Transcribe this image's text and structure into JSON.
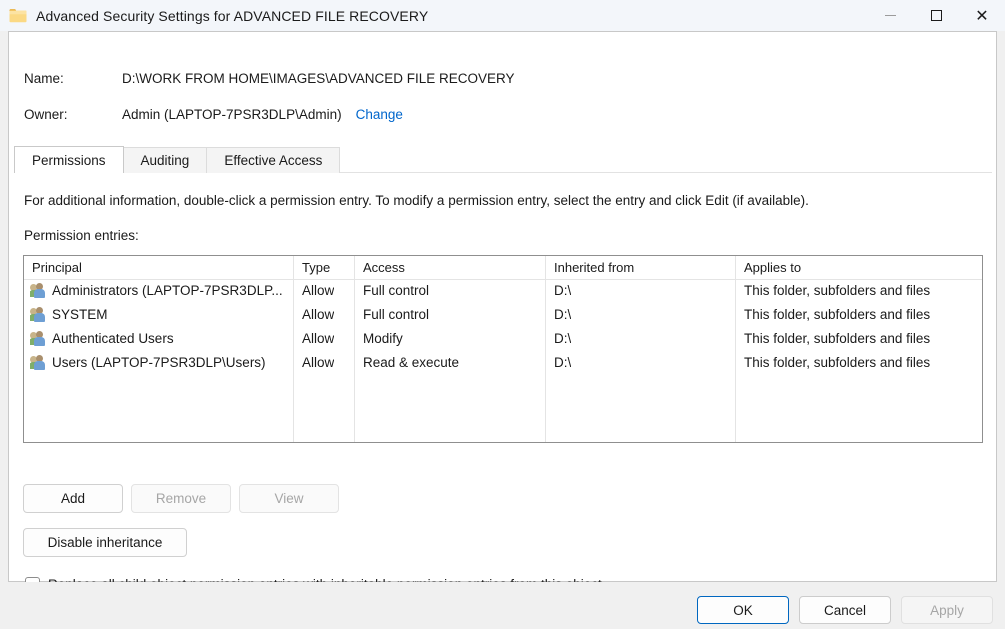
{
  "window": {
    "title": "Advanced Security Settings for ADVANCED FILE RECOVERY",
    "folder_icon": "folder-icon",
    "minimize_label": "Minimize",
    "maximize_label": "Maximize",
    "close_label": "Close"
  },
  "header": {
    "name_label": "Name:",
    "name_value": "D:\\WORK FROM HOME\\IMAGES\\ADVANCED FILE RECOVERY",
    "owner_label": "Owner:",
    "owner_value": "Admin (LAPTOP-7PSR3DLP\\Admin)",
    "change_link": "Change"
  },
  "tabs": [
    {
      "label": "Permissions",
      "active": true
    },
    {
      "label": "Auditing",
      "active": false
    },
    {
      "label": "Effective Access",
      "active": false
    }
  ],
  "main": {
    "info_text": "For additional information, double-click a permission entry. To modify a permission entry, select the entry and click Edit (if available).",
    "entries_label": "Permission entries:"
  },
  "table": {
    "columns": [
      "Principal",
      "Type",
      "Access",
      "Inherited from",
      "Applies to"
    ],
    "rows": [
      {
        "principal": "Administrators (LAPTOP-7PSR3DLP...",
        "type": "Allow",
        "access": "Full control",
        "inherited_from": "D:\\",
        "applies_to": "This folder, subfolders and files"
      },
      {
        "principal": "SYSTEM",
        "type": "Allow",
        "access": "Full control",
        "inherited_from": "D:\\",
        "applies_to": "This folder, subfolders and files"
      },
      {
        "principal": "Authenticated Users",
        "type": "Allow",
        "access": "Modify",
        "inherited_from": "D:\\",
        "applies_to": "This folder, subfolders and files"
      },
      {
        "principal": "Users (LAPTOP-7PSR3DLP\\Users)",
        "type": "Allow",
        "access": "Read & execute",
        "inherited_from": "D:\\",
        "applies_to": "This folder, subfolders and files"
      }
    ]
  },
  "actions": {
    "add": "Add",
    "remove": "Remove",
    "view": "View",
    "disable_inheritance": "Disable inheritance",
    "replace_checkbox_label": "Replace all child object permission entries with inheritable permission entries from this object",
    "replace_checked": false
  },
  "footer": {
    "ok": "OK",
    "cancel": "Cancel",
    "apply": "Apply"
  },
  "colors": {
    "accent": "#0067C0",
    "link": "#0066CC",
    "titlebar_bg": "#F3F6FA",
    "footer_bg": "#F0F0F0",
    "panel_bg": "#FFFFFF"
  }
}
